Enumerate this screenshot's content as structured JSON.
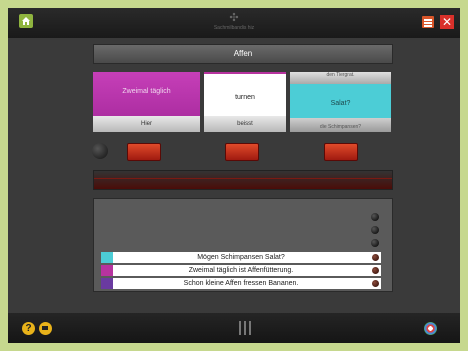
{
  "header": {
    "app_title": "Sachmilbandis hiz",
    "logo_glyph": "✣",
    "close_glyph": "✕"
  },
  "exercise": {
    "topic": "Affen",
    "cards": [
      {
        "middle": "Zweimal täglich",
        "bottom": "Hier",
        "color": "#b7339f"
      },
      {
        "middle": "turnen",
        "bottom": "beisst",
        "color": "#ffffff"
      },
      {
        "top": "den Tiergrat.",
        "middle": "Salat?",
        "bottom": "die Schimpansen?",
        "color": "#4ccdd6"
      }
    ]
  },
  "sentences": [
    {
      "text": "Mögen Schimpansen Salat?",
      "color": "#4ccdd6"
    },
    {
      "text": "Zweimal täglich ist Affenfütterung.",
      "color": "#b7339f"
    },
    {
      "text": "Schon kleine Affen fressen Bananen.",
      "color": "#6a3aa0"
    }
  ],
  "footer": {
    "help_glyph": "?"
  },
  "colors": {
    "background": "#c6d88e",
    "accent_red": "#d8302a",
    "home_green": "#8fb43f"
  }
}
